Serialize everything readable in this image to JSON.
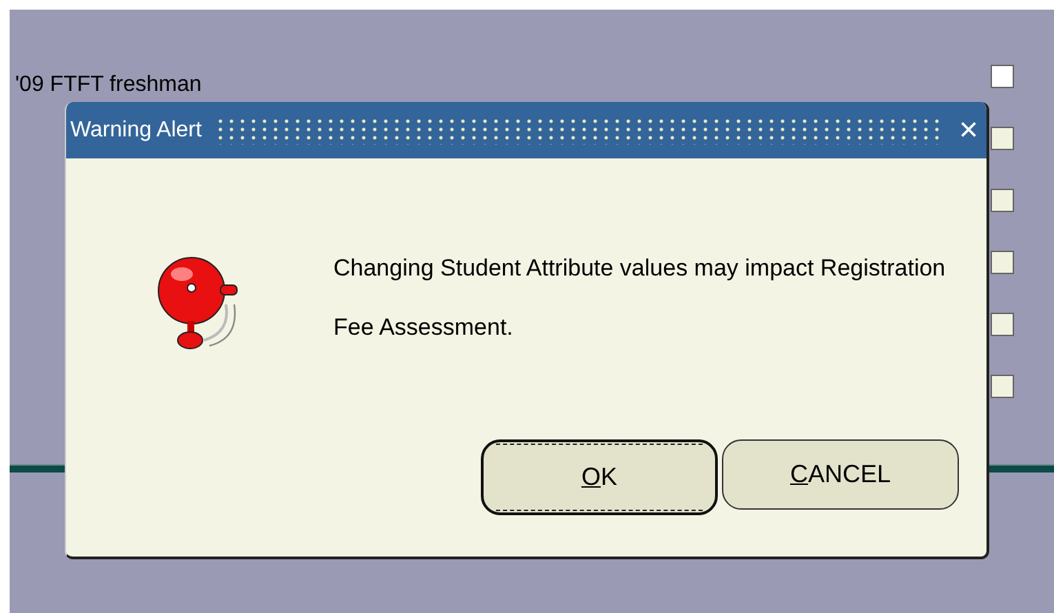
{
  "form": {
    "label": "'09 FTFT freshman",
    "checkboxes": [
      {
        "checked": false,
        "disabled": false
      },
      {
        "checked": false,
        "disabled": true
      },
      {
        "checked": false,
        "disabled": true
      },
      {
        "checked": false,
        "disabled": true
      },
      {
        "checked": false,
        "disabled": true
      },
      {
        "checked": false,
        "disabled": true
      }
    ]
  },
  "dialog": {
    "title": "Warning Alert",
    "close": "×",
    "message": "Changing Student Attribute values may impact Registration Fee Assessment.",
    "buttons": [
      {
        "label": "OK",
        "focused": true
      },
      {
        "label": "CANCEL",
        "focused": false
      }
    ]
  }
}
